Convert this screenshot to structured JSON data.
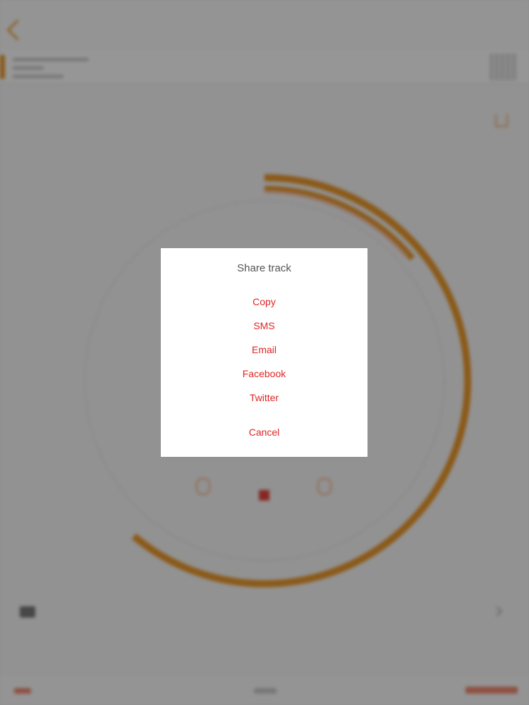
{
  "dialog": {
    "title": "Share track",
    "options": [
      {
        "label": "Copy"
      },
      {
        "label": "SMS"
      },
      {
        "label": "Email"
      },
      {
        "label": "Facebook"
      },
      {
        "label": "Twitter"
      }
    ],
    "cancel_label": "Cancel"
  },
  "colors": {
    "accent_red": "#e02424",
    "progress_orange": "#e8962a",
    "dim_overlay": "rgba(0,0,0,0.4)"
  },
  "icons": {
    "back": "chevron-left-icon",
    "share": "share-icon",
    "rewind": "rewind-icon",
    "stop": "stop-icon",
    "fast_forward": "fast-forward-icon",
    "list": "list-icon"
  }
}
